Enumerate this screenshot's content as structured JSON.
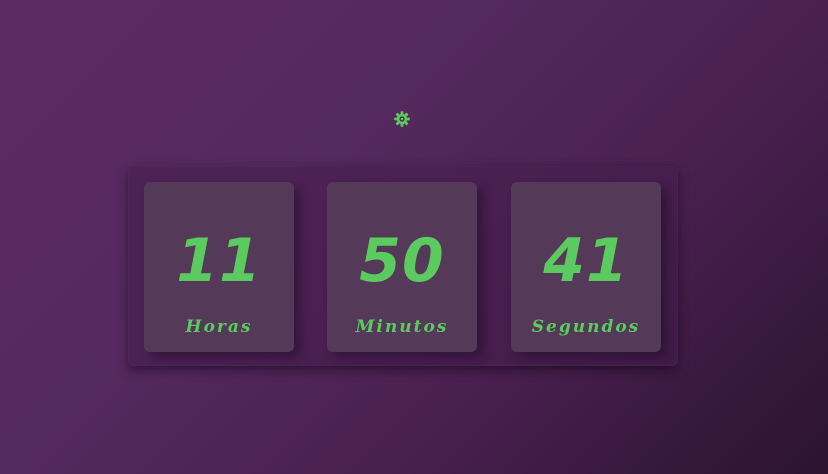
{
  "settings": {
    "icon": "gear-icon",
    "color": "#5ccb5f"
  },
  "countdown": {
    "units": [
      {
        "value": "11",
        "label": "Horas"
      },
      {
        "value": "50",
        "label": "Minutos"
      },
      {
        "value": "41",
        "label": "Segundos"
      }
    ]
  },
  "colors": {
    "accent": "#5ccb5f",
    "card": "#543958",
    "background_start": "#5c2a63",
    "background_end": "#2b1430"
  }
}
